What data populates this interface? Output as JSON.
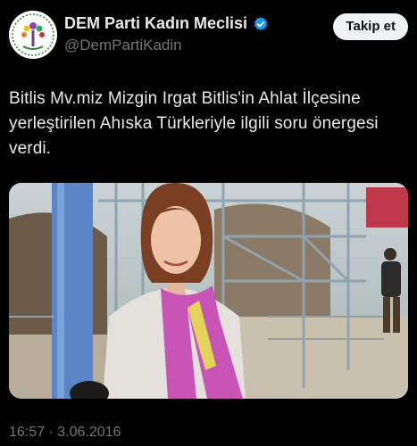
{
  "account": {
    "display_name": "DEM Parti Kadın Meclisi",
    "handle": "@DemPartiKadin",
    "verified_color": "#1d9bf0"
  },
  "follow_button": {
    "label": "Takip et"
  },
  "tweet": {
    "text": "Bitlis Mv.miz Mizgin Irgat Bitlis'in Ahlat İlçesine yerleştirilen Ahıska Türkleriyle ilgili soru önergesi verdi.",
    "timestamp": "16:57 · 3.06.2016"
  },
  "icons": {
    "avatar": "dem-parti-logo-icon",
    "verified": "verified-badge-icon"
  }
}
